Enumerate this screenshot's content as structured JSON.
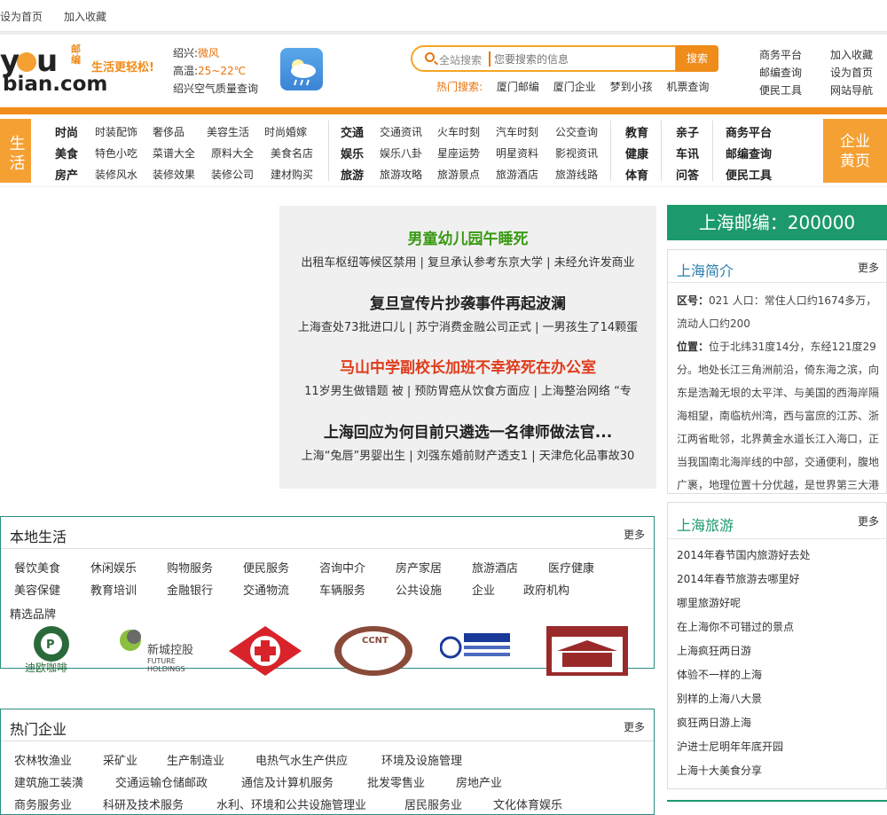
{
  "topbar": {
    "set_home": "设为首页",
    "bookmark": "加入收藏"
  },
  "logo": {
    "brand": "youbian.com",
    "slogan": "生活更轻松!",
    "badge": "邮编"
  },
  "weather": {
    "city_label": "绍兴:",
    "condition": "微风",
    "temp_label": "高温:",
    "temp": "25~22℃",
    "air": "绍兴空气质量查询"
  },
  "search": {
    "scope": "全站搜索",
    "placeholder": "您要搜索的信息",
    "button": "搜索"
  },
  "hot": {
    "label": "热门搜索:",
    "items": [
      "厦门邮编",
      "厦门企业",
      "梦到小孩",
      "机票查询"
    ]
  },
  "right_links": {
    "col1": [
      "商务平台",
      "邮编查询",
      "便民工具"
    ],
    "col2": [
      "加入收藏",
      "设为首页",
      "网站导航"
    ]
  },
  "nav": {
    "left_tab": "生活",
    "right_tab_line1": "企业",
    "right_tab_line2": "黄页",
    "groups": [
      {
        "head": [
          "时尚",
          "美食",
          "房产"
        ],
        "rows": [
          [
            "时装配饰",
            "奢侈品",
            "美容生活",
            "时尚婚嫁"
          ],
          [
            "特色小吃",
            "菜谱大全",
            "原料大全",
            "美食名店"
          ],
          [
            "装修风水",
            "装修效果",
            "装修公司",
            "建材购买"
          ]
        ]
      },
      {
        "head": [
          "交通",
          "娱乐",
          "旅游"
        ],
        "rows": [
          [
            "交通资讯",
            "火车时刻",
            "汽车时刻",
            "公交查询"
          ],
          [
            "娱乐八卦",
            "星座运势",
            "明星资料",
            "影视资讯"
          ],
          [
            "旅游攻略",
            "旅游景点",
            "旅游酒店",
            "旅游线路"
          ]
        ]
      }
    ],
    "col_a": [
      "教育",
      "健康",
      "体育"
    ],
    "col_b": [
      "亲子",
      "车讯",
      "问答"
    ],
    "col_c": [
      "商务平台",
      "邮编查询",
      "便民工具"
    ]
  },
  "news": [
    {
      "headline": "男童幼儿园午睡死",
      "sub": "出租车枢纽等候区禁用 | 复旦承认参考东京大学 | 未经允许发商业"
    },
    {
      "headline": "复旦宣传片抄袭事件再起波澜",
      "sub": "上海查处73批进口儿 | 苏宁消费金融公司正式 | 一男孩生了14颗蛋"
    },
    {
      "headline": "马山中学副校长加班不幸猝死在办公室",
      "sub": "11岁男生做错题 被 | 预防胃癌从饮食方面应 | 上海整治网络 “专"
    },
    {
      "headline": "上海回应为何目前只遴选一名律师做法官...",
      "sub": "上海“兔唇”男婴出生 | 刘强东婚前财产透支1 | 天津危化品事故30"
    }
  ],
  "zipcode": "上海邮编：200000",
  "intro": {
    "title": "上海简介",
    "more": "更多",
    "district_label": "区号：",
    "district": "021 人口：常住人口约1674多万，流动人口约200",
    "location_label": "位置：",
    "location": "位于北纬31度14分，东经121度29分。地处长江三角洲前沿，倚东海之滨，向东是浩瀚无垠的太平洋、与美国的西海岸隔海相望，南临杭州湾，西与富庶的江苏、浙江两省毗邻，北界黄金水道长江入海口，正当我国南北海岸线的中部，交通便利，腹地广裹，地理位置十分优越，是世界第三大港"
  },
  "travel": {
    "title": "上海旅游",
    "more": "更多",
    "items": [
      "2014年春节国内旅游好去处",
      "2014年春节旅游去哪里好",
      "哪里旅游好呢",
      "在上海你不可错过的景点",
      "上海疯狂两日游",
      "体验不一样的上海",
      "别样的上海八大景",
      "疯狂两日游上海",
      "沪进士尼明年年底开园",
      "上海十大美食分享"
    ]
  },
  "local": {
    "title": "本地生活",
    "more": "更多",
    "row1": [
      "餐饮美食",
      "休闲娱乐",
      "购物服务",
      "便民服务",
      "咨询中介",
      "房产家居",
      "旅游酒店",
      "医疗健康"
    ],
    "row2": [
      "美容保健",
      "教育培训",
      "金融银行",
      "交通物流",
      "车辆服务",
      "公共设施",
      "企业",
      "政府机构"
    ],
    "brands_label": "精选品牌",
    "brand_texts": [
      "迪欧咖啡",
      "新城控股",
      "FUTURE HOLDINGS",
      "CCNT"
    ]
  },
  "hotcorp": {
    "title": "热门企业",
    "more": "更多",
    "row1": [
      "农林牧渔业",
      "采矿业",
      "生产制造业",
      "电热气水生产供应",
      "环境及设施管理"
    ],
    "row2": [
      "建筑施工装潢",
      "交通运输仓储邮政",
      "通信及计算机服务",
      "批发零售业",
      "房地产业"
    ],
    "row3": [
      "商务服务业",
      "科研及技术服务",
      "水利、环境和公共设施管理业",
      "居民服务业",
      "文化体育娱乐"
    ]
  },
  "colors": {
    "orange": "#f08c1a",
    "green": "#1c9a6c",
    "link_blue": "#2a7fb0"
  }
}
